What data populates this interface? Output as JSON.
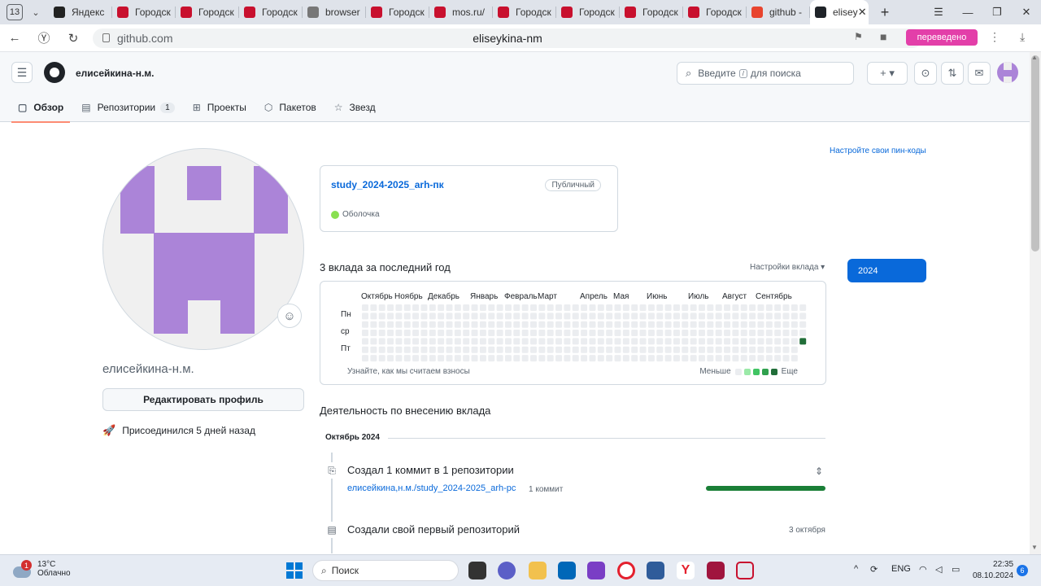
{
  "browser": {
    "tab_count": "13",
    "tabs": [
      {
        "label": "Яндекс",
        "color": "#222222"
      },
      {
        "label": "Городск",
        "color": "#c8102e"
      },
      {
        "label": "Городск",
        "color": "#c8102e"
      },
      {
        "label": "Городск",
        "color": "#c8102e"
      },
      {
        "label": "browser",
        "color": "#777777"
      },
      {
        "label": "Городск",
        "color": "#c8102e"
      },
      {
        "label": "mos.ru/",
        "color": "#c8102e"
      },
      {
        "label": "Городск",
        "color": "#c8102e"
      },
      {
        "label": "Городск",
        "color": "#c8102e"
      },
      {
        "label": "Городск",
        "color": "#c8102e"
      },
      {
        "label": "Городск",
        "color": "#c8102e"
      },
      {
        "label": "github -",
        "color": "#e8442e"
      },
      {
        "label": "elisey",
        "color": "#1f2328"
      }
    ],
    "new_tab": "+",
    "domain": "github.com",
    "page_title": "eliseykina-nm",
    "translated_badge": "переведено"
  },
  "header": {
    "username": "елисейкина-н.м.",
    "search_placeholder": "Введите",
    "search_key": "/",
    "search_suffix": "для поиска",
    "plus_label": "+ ▾"
  },
  "nav": {
    "tabs": [
      {
        "label": "Обзор",
        "icon": "book-icon"
      },
      {
        "label": "Репозитории",
        "icon": "repo-icon",
        "count": "1"
      },
      {
        "label": "Проекты",
        "icon": "table-icon"
      },
      {
        "label": "Пакетов",
        "icon": "package-icon"
      },
      {
        "label": "Звезд",
        "icon": "star-icon"
      }
    ]
  },
  "profile": {
    "name": "елисейкина-н.м.",
    "edit_button": "Редактировать профиль",
    "joined": "Присоединился 5 дней назад",
    "avatar_color": "#ab84d8"
  },
  "pinned": {
    "customize_link": "Настройте свои пин-коды",
    "repo_name": "study_2024-2025_arh-пк",
    "visibility": "Публичный",
    "language": "Оболочка",
    "language_color": "#89e051"
  },
  "contributions": {
    "title": "3 вклада за последний год",
    "settings": "Настройки вклада ▾",
    "year": "2024",
    "months": [
      "Октябрь",
      "Ноябрь",
      "Декабрь",
      "Январь",
      "Февраль",
      "Март",
      "Апрель",
      "Мая",
      "Июнь",
      "Июль",
      "Август",
      "Сентябрь"
    ],
    "days": [
      "Пн",
      "ср",
      "Пт"
    ],
    "learn_link": "Узнайте, как мы считаем взносы",
    "legend_less": "Меньше",
    "legend_more": "Еще",
    "legend_colors": [
      "#ebedf0",
      "#9be9a8",
      "#40c463",
      "#30a14e",
      "#216e39"
    ],
    "highlight_week": 52,
    "highlight_day": 4
  },
  "activity": {
    "title": "Деятельность по внесению вклада",
    "month": "Октябрь 2024",
    "event1_title": "Создал 1 коммит в 1 репозитории",
    "event1_repo": "елисейкина,н.м./study_2024-2025_arh-pc",
    "event1_count": "1 коммит",
    "event2_title": "Создали свой первый репозиторий",
    "event2_date": "3 октября"
  },
  "taskbar": {
    "temp": "13°C",
    "weather": "Облачно",
    "weather_badge": "1",
    "search": "Поиск",
    "lang": "ENG",
    "time": "22:35",
    "date": "08.10.2024",
    "notif_count": "6"
  }
}
